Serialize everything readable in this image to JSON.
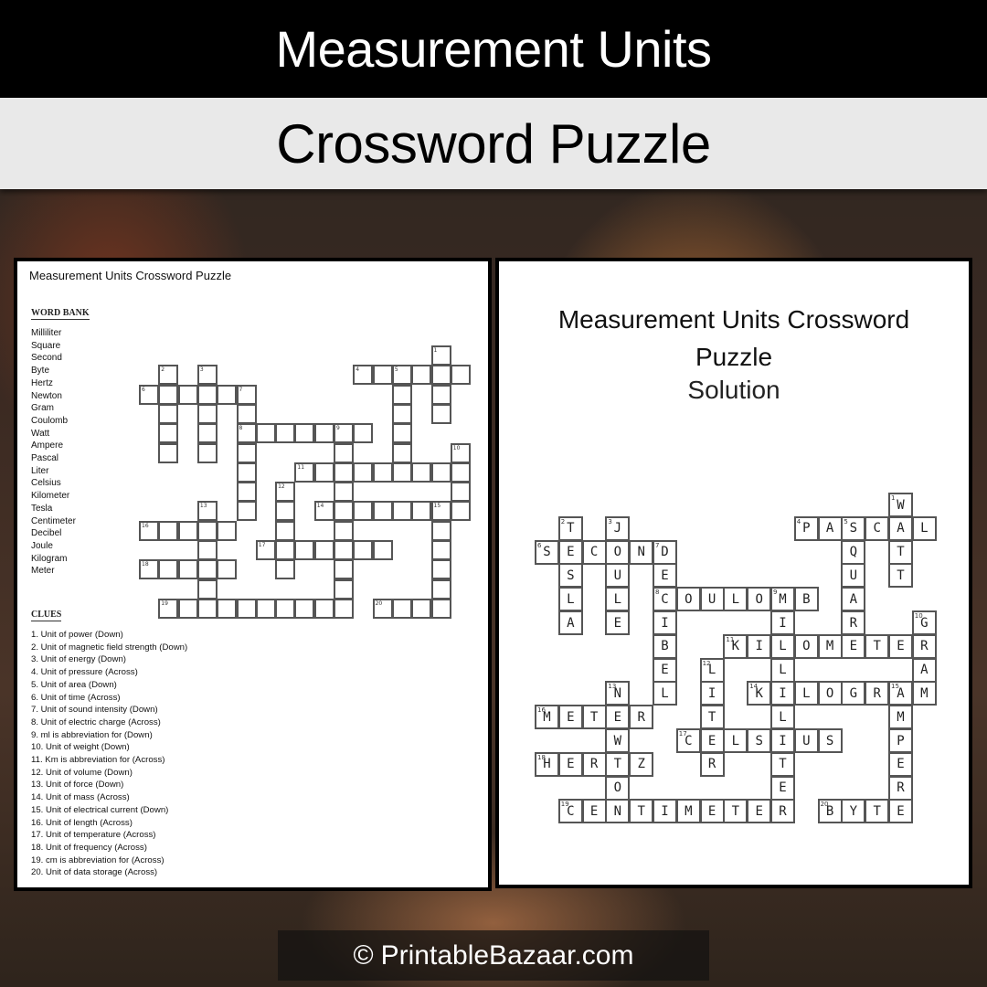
{
  "header": {
    "title": "Measurement Units",
    "subtitle": "Crossword Puzzle"
  },
  "puzzle_page": {
    "title": "Measurement Units Crossword Puzzle",
    "word_bank_heading": "WORD BANK",
    "word_bank": [
      "Milliliter",
      "Square",
      "Second",
      "Byte",
      "Hertz",
      "Newton",
      "Gram",
      "Coulomb",
      "Watt",
      "Ampere",
      "Pascal",
      "Liter",
      "Celsius",
      "Kilometer",
      "Tesla",
      "Centimeter",
      "Decibel",
      "Joule",
      "Kilogram",
      "Meter"
    ],
    "clues_heading": "CLUES",
    "clues": [
      "1. Unit of power (Down)",
      "2. Unit of magnetic field strength (Down)",
      "3. Unit of energy (Down)",
      "4. Unit of pressure (Across)",
      "5. Unit of area (Down)",
      "6. Unit of time (Across)",
      "7. Unit of sound intensity (Down)",
      "8. Unit of electric charge (Across)",
      "9. ml is abbreviation for  (Down)",
      "10. Unit of weight (Down)",
      "11. Km is abbreviation for (Across)",
      "12. Unit of volume (Down)",
      "13. Unit of force (Down)",
      "14. Unit of mass (Across)",
      "15. Unit of electrical current (Down)",
      "16. Unit of length (Across)",
      "17. Unit of temperature  (Across)",
      "18. Unit of frequency (Across)",
      "19. cm is abbreviation for (Across)",
      "20. Unit of data storage (Across)"
    ]
  },
  "solution_page": {
    "title_line1": "Measurement Units Crossword",
    "title_line2": "Puzzle",
    "title_line3": "Solution"
  },
  "crossword": {
    "entries": [
      {
        "num": 1,
        "dir": "down",
        "row": 0,
        "col": 15,
        "answer": "WATT"
      },
      {
        "num": 2,
        "dir": "down",
        "row": 1,
        "col": 1,
        "answer": "TESLA"
      },
      {
        "num": 3,
        "dir": "down",
        "row": 1,
        "col": 3,
        "answer": "JOULE"
      },
      {
        "num": 4,
        "dir": "across",
        "row": 1,
        "col": 11,
        "answer": "PASCAL"
      },
      {
        "num": 5,
        "dir": "down",
        "row": 1,
        "col": 13,
        "answer": "SQUARE"
      },
      {
        "num": 6,
        "dir": "across",
        "row": 2,
        "col": 0,
        "answer": "SECOND"
      },
      {
        "num": 7,
        "dir": "down",
        "row": 2,
        "col": 5,
        "answer": "DECIBEL"
      },
      {
        "num": 8,
        "dir": "across",
        "row": 4,
        "col": 5,
        "answer": "COULOMB"
      },
      {
        "num": 9,
        "dir": "down",
        "row": 4,
        "col": 10,
        "answer": "MILLILITER"
      },
      {
        "num": 10,
        "dir": "down",
        "row": 5,
        "col": 16,
        "answer": "GRAM"
      },
      {
        "num": 11,
        "dir": "across",
        "row": 6,
        "col": 8,
        "answer": "KILOMETER"
      },
      {
        "num": 12,
        "dir": "down",
        "row": 7,
        "col": 7,
        "answer": "LITER"
      },
      {
        "num": 13,
        "dir": "down",
        "row": 8,
        "col": 3,
        "answer": "NEWTON"
      },
      {
        "num": 14,
        "dir": "across",
        "row": 8,
        "col": 9,
        "answer": "KILOGRAM"
      },
      {
        "num": 15,
        "dir": "down",
        "row": 8,
        "col": 15,
        "answer": "AMPERE"
      },
      {
        "num": 16,
        "dir": "across",
        "row": 9,
        "col": 0,
        "answer": "METER"
      },
      {
        "num": 17,
        "dir": "across",
        "row": 10,
        "col": 6,
        "answer": "CELSIUS"
      },
      {
        "num": 18,
        "dir": "across",
        "row": 11,
        "col": 0,
        "answer": "HERTZ"
      },
      {
        "num": 19,
        "dir": "across",
        "row": 13,
        "col": 1,
        "answer": "CENTIMETER"
      },
      {
        "num": 20,
        "dir": "across",
        "row": 13,
        "col": 12,
        "answer": "BYTE"
      }
    ]
  },
  "footer": {
    "copyright_symbol": "©",
    "site": "PrintableBazaar.com"
  }
}
